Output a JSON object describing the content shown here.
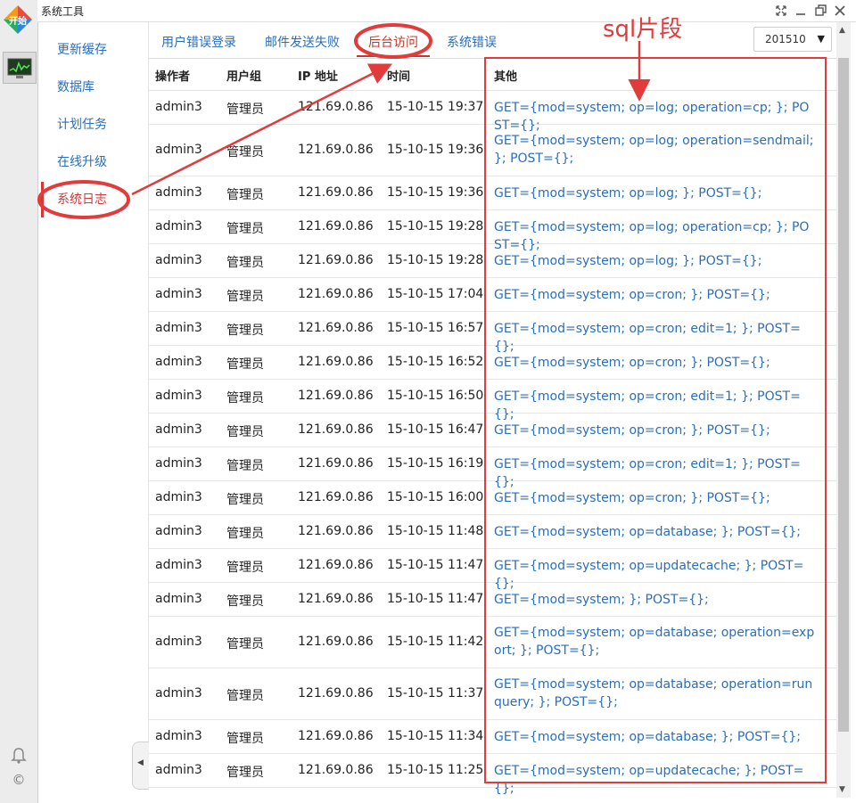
{
  "window": {
    "title": "系统工具"
  },
  "start": {
    "label": "开始"
  },
  "sidebar": {
    "items": [
      {
        "label": "更新缓存",
        "active": false
      },
      {
        "label": "数据库",
        "active": false
      },
      {
        "label": "计划任务",
        "active": false
      },
      {
        "label": "在线升级",
        "active": false
      },
      {
        "label": "系统日志",
        "active": true
      }
    ]
  },
  "tabs": [
    {
      "label": "用户错误登录",
      "active": false
    },
    {
      "label": "邮件发送失败",
      "active": false
    },
    {
      "label": "后台访问",
      "active": true
    },
    {
      "label": "系统错误",
      "active": false
    }
  ],
  "month_select": {
    "value": "201510"
  },
  "table": {
    "headers": [
      "操作者",
      "用户组",
      "IP 地址",
      "时间",
      "其他"
    ],
    "rows": [
      [
        "admin3",
        "管理员",
        "121.69.0.86",
        "15-10-15 19:37",
        "GET={mod=system; op=log; operation=cp; }; POST={};"
      ],
      [
        "admin3",
        "管理员",
        "121.69.0.86",
        "15-10-15 19:36",
        "GET={mod=system; op=log; operation=sendmail; }; POST={};"
      ],
      [
        "admin3",
        "管理员",
        "121.69.0.86",
        "15-10-15 19:36",
        "GET={mod=system; op=log; }; POST={};"
      ],
      [
        "admin3",
        "管理员",
        "121.69.0.86",
        "15-10-15 19:28",
        "GET={mod=system; op=log; operation=cp; }; POST={};"
      ],
      [
        "admin3",
        "管理员",
        "121.69.0.86",
        "15-10-15 19:28",
        "GET={mod=system; op=log; }; POST={};"
      ],
      [
        "admin3",
        "管理员",
        "121.69.0.86",
        "15-10-15 17:04",
        "GET={mod=system; op=cron; }; POST={};"
      ],
      [
        "admin3",
        "管理员",
        "121.69.0.86",
        "15-10-15 16:57",
        "GET={mod=system; op=cron; edit=1; }; POST={};"
      ],
      [
        "admin3",
        "管理员",
        "121.69.0.86",
        "15-10-15 16:52",
        "GET={mod=system; op=cron; }; POST={};"
      ],
      [
        "admin3",
        "管理员",
        "121.69.0.86",
        "15-10-15 16:50",
        "GET={mod=system; op=cron; edit=1; }; POST={};"
      ],
      [
        "admin3",
        "管理员",
        "121.69.0.86",
        "15-10-15 16:47",
        "GET={mod=system; op=cron; }; POST={};"
      ],
      [
        "admin3",
        "管理员",
        "121.69.0.86",
        "15-10-15 16:19",
        "GET={mod=system; op=cron; edit=1; }; POST={};"
      ],
      [
        "admin3",
        "管理员",
        "121.69.0.86",
        "15-10-15 16:00",
        "GET={mod=system; op=cron; }; POST={};"
      ],
      [
        "admin3",
        "管理员",
        "121.69.0.86",
        "15-10-15 11:48",
        "GET={mod=system; op=database; }; POST={};"
      ],
      [
        "admin3",
        "管理员",
        "121.69.0.86",
        "15-10-15 11:47",
        "GET={mod=system; op=updatecache; }; POST={};"
      ],
      [
        "admin3",
        "管理员",
        "121.69.0.86",
        "15-10-15 11:47",
        "GET={mod=system; }; POST={};"
      ],
      [
        "admin3",
        "管理员",
        "121.69.0.86",
        "15-10-15 11:42",
        "GET={mod=system; op=database; operation=export; }; POST={};"
      ],
      [
        "admin3",
        "管理员",
        "121.69.0.86",
        "15-10-15 11:37",
        "GET={mod=system; op=database; operation=runquery; }; POST={};"
      ],
      [
        "admin3",
        "管理员",
        "121.69.0.86",
        "15-10-15 11:34",
        "GET={mod=system; op=database; }; POST={};"
      ],
      [
        "admin3",
        "管理员",
        "121.69.0.86",
        "15-10-15 11:25",
        "GET={mod=system; op=updatecache; }; POST={};"
      ]
    ]
  },
  "annotation": {
    "title": "sql片段",
    "color": "#e23b3b"
  },
  "colors": {
    "link": "#2a6ebb",
    "active": "#c0392b"
  },
  "icons": [
    "start-logo-icon",
    "monitor-icon",
    "bell-icon",
    "copyright-icon",
    "fullscreen-icon",
    "minimize-icon",
    "restore-icon",
    "close-icon",
    "chevron-left-icon",
    "caret-down-icon"
  ]
}
